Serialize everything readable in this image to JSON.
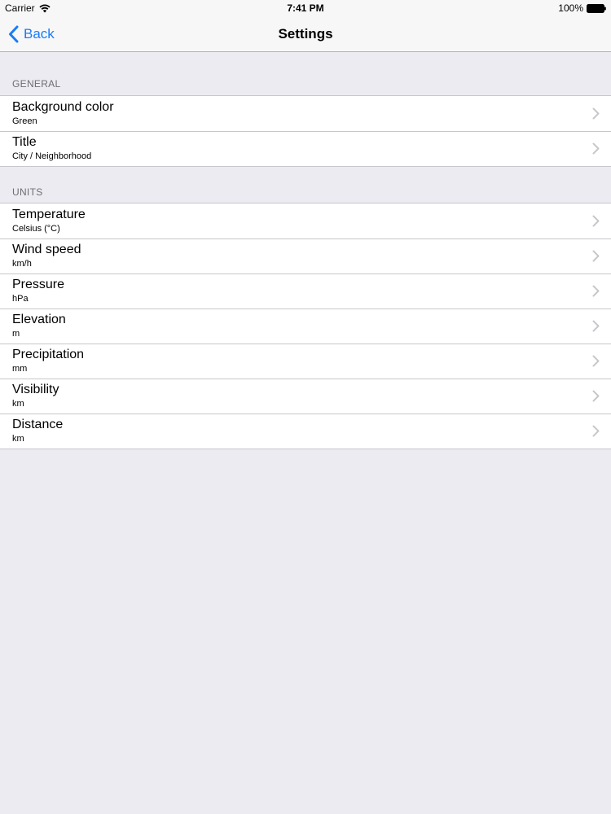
{
  "status_bar": {
    "carrier": "Carrier",
    "time": "7:41 PM",
    "battery": "100%"
  },
  "nav": {
    "back_label": "Back",
    "title": "Settings"
  },
  "sections": {
    "general": {
      "header": "GENERAL",
      "rows": [
        {
          "title": "Background color",
          "value": "Green"
        },
        {
          "title": "Title",
          "value": "City / Neighborhood"
        }
      ]
    },
    "units": {
      "header": "UNITS",
      "rows": [
        {
          "title": "Temperature",
          "value": "Celsius (°C)"
        },
        {
          "title": "Wind speed",
          "value": "km/h"
        },
        {
          "title": "Pressure",
          "value": "hPa"
        },
        {
          "title": "Elevation",
          "value": "m"
        },
        {
          "title": "Precipitation",
          "value": "mm"
        },
        {
          "title": "Visibility",
          "value": "km"
        },
        {
          "title": "Distance",
          "value": "km"
        }
      ]
    }
  },
  "colors": {
    "accent": "#1a7cf5",
    "background": "#ebebf1",
    "separator": "#c8c7cc",
    "section_header": "#6d6d72"
  },
  "icons": {
    "wifi": "wifi-icon",
    "battery": "battery-icon",
    "back": "chevron-left-icon",
    "disclosure": "chevron-right-icon"
  }
}
